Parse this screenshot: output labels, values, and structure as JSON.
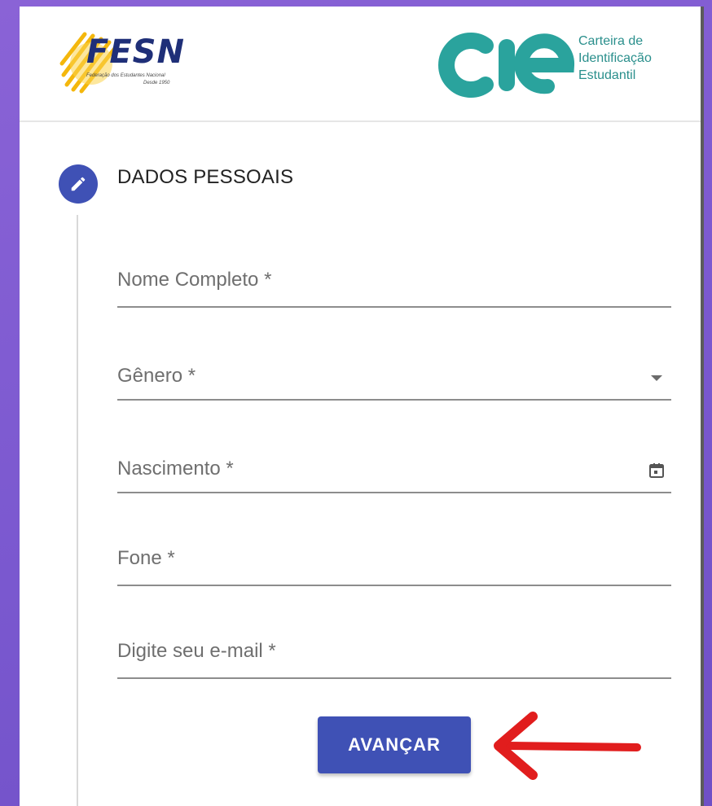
{
  "header": {
    "left_logo": {
      "name": "FESN",
      "line1": "Federação dos Estudantes Nacional",
      "line2": "Desde 1950"
    },
    "right_logo": {
      "mark": "cie",
      "lines": [
        "Carteira de",
        "Identificação",
        "Estudantil"
      ]
    }
  },
  "step": {
    "icon": "pencil-icon",
    "title": "DADOS PESSOAIS"
  },
  "form": {
    "full_name": {
      "placeholder": "Nome Completo *",
      "value": ""
    },
    "gender": {
      "label": "Gênero *",
      "value": "",
      "icon": "dropdown-caret-icon"
    },
    "birth": {
      "label": "Nascimento *",
      "value": "",
      "icon": "calendar-icon"
    },
    "phone": {
      "placeholder": "Fone *",
      "value": ""
    },
    "email": {
      "placeholder": "Digite seu e-mail *",
      "value": ""
    }
  },
  "actions": {
    "next_label": "AVANÇAR"
  },
  "colors": {
    "primary": "#3f51b5",
    "cie_teal": "#2a8f8c",
    "annotation_arrow": "#e11d1d",
    "background": "#7a58cf"
  }
}
